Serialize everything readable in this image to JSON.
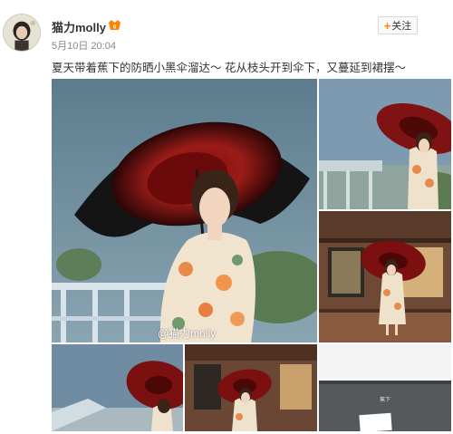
{
  "post": {
    "username": "猫力molly",
    "timestamp": "5月10日 20:04",
    "follow_label": "关注",
    "text": "夏天带着蕉下的防晒小黑伞溜达～ 花从枝头开到伞下，又蔓延到裙摆～",
    "watermark": "@猫力molly",
    "photo_label": "蕉下"
  },
  "icons": {
    "avatar": "avatar-portrait",
    "verified": "vip-badge-icon",
    "plus": "plus-icon"
  },
  "colors": {
    "accent": "#ff8200",
    "text": "#333333",
    "meta": "#888888",
    "umbrella_red": "#8e1414"
  }
}
